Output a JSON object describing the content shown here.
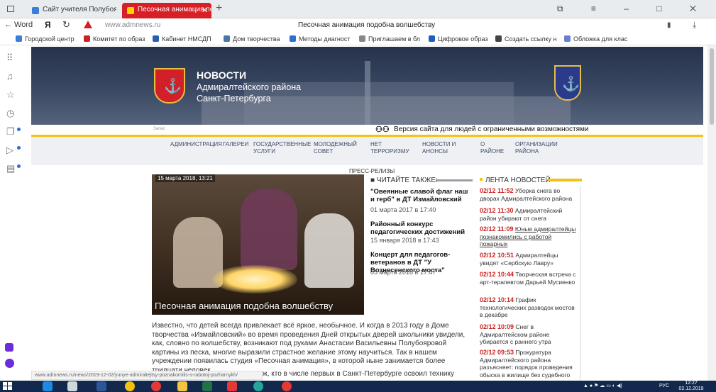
{
  "browser": {
    "tabs": [
      {
        "label": "Сайт учителя Полубояро"
      },
      {
        "label": "Песочная анимация по"
      }
    ],
    "new_tab": "+",
    "back_label": "← Word",
    "yandex": "Я",
    "reload": "↻",
    "url": "www.admnews.ru",
    "page_title": "Песочная анимация подобна волшебству",
    "window_controls": "⧉ ≡ – □ ✕",
    "bookmark_icon": "bookmark-icon",
    "download_icon": "download-icon",
    "bookmarks": [
      {
        "label": "Городской центр",
        "color": "#3b7dd8"
      },
      {
        "label": "Комитет по образ",
        "color": "#c22"
      },
      {
        "label": "Кабинет НМСДП",
        "color": "#2a5ea8"
      },
      {
        "label": "Дом творчества",
        "color": "#4a76a8"
      },
      {
        "label": "Методы диагност",
        "color": "#2b6fd6"
      },
      {
        "label": "Приглашаем в бл",
        "color": "#888"
      },
      {
        "label": "Цифровое образ",
        "color": "#1f5fbf"
      },
      {
        "label": "Создать ссылку н",
        "color": "#444"
      },
      {
        "label": "Обложка для клас",
        "color": "#6b7fd0"
      }
    ],
    "status_url": "www.admnews.ru/news/2019-12-02/yunye-admiraltejtsy-poznakomilis-s-rabotoj-pozharnykh/"
  },
  "site": {
    "brand": {
      "title": "НОВОСТИ",
      "line1": "Адмиралтейского района",
      "line2": "Санкт-Петербурга"
    },
    "search_placeholder": "Запис",
    "accessibility_icon": "⚇⚇",
    "accessibility_text": "Версия сайта для людей с ограниченными возможностями",
    "nav": [
      "АДМИНИСТРАЦИЯ",
      "ГАЛЕРЕИ",
      "ГОСУДАРСТВЕННЫЕ УСЛУГИ",
      "МОЛОДЕЖНЫЙ СОВЕТ",
      "НЕТ ТЕРРОРИЗМУ",
      "НОВОСТИ И АНОНСЫ",
      "О РАЙОНЕ",
      "ОРГАНИЗАЦИИ РАЙОНА"
    ],
    "section_label": "ПРЕСС-РЕЛИЗЫ",
    "hero": {
      "date": "15 марта 2018, 13:21",
      "caption": "Песочная анимация подобна волшебству"
    },
    "article": {
      "text": "Известно, что детей всегда привлекает всё яркое, необычное. И когда в 2013 году в Доме творчества «Измайловский» во время проведения Дней открытых дверей школьники увидели, как, словно по волшебству, возникают под руками Анастасии Васильевны Полубояровой картины из песка, многие выразили страстное желание этому научиться. Так в нашем учреждении появилась студия «Песочная анимация», в которой ныне занимается более тридцати человек.",
      "continuation": "ж, кто в числе первых в Санкт-Петербурге освоил технику"
    },
    "read_also": {
      "heading": "■ ЧИТАЙТЕ ТАКЖЕ:",
      "items": [
        {
          "title": "\"Овеянные славой флаг наш и герб\" в ДТ Измайловский",
          "date": "01 марта 2017 в 17:40"
        },
        {
          "title": "Районный конкурс педагогических достижений",
          "date": "15 января 2018 в 17:43"
        },
        {
          "title": "Концерт для педагогов-ветеранов в ДТ \"У Вознесенского моста\"",
          "date": "05 марта 2018 в 17:47"
        }
      ]
    },
    "feed": {
      "heading": "ЛЕНТА НОВОСТЕЙ",
      "items": [
        {
          "time": "02/12 11:52",
          "text": "Уборка снега во дворах Адмиралтейского района"
        },
        {
          "time": "02/12 11:30",
          "text": "Адмиралтейский район убирают от снега"
        },
        {
          "time": "02/12 11:09",
          "text": "Юные адмиралтейцы познакомились с работой пожарных"
        },
        {
          "time": "02/12 10:51",
          "text": "Адмиралтейцы увидят «Сербскую Лавру»"
        },
        {
          "time": "02/12 10:44",
          "text": "Творческая встреча с арт-терапевтом Дарьей Мусиенко"
        },
        {
          "time": "02/12 10:14",
          "text": "График технологических разводок мостов в декабре"
        },
        {
          "time": "02/12 10:09",
          "text": "Снег в Адмиралтейском районе убирается с раннего утра"
        },
        {
          "time": "02/12 09:53",
          "text": "Прокуратура Адмиралтейского района разъясняет: порядок проведения обыска в жилище без судебного"
        }
      ]
    }
  },
  "taskbar": {
    "apps": [
      {
        "name": "edge-icon",
        "color": "#1e88e5"
      },
      {
        "name": "media-icon",
        "color": "#cfd8dc"
      },
      {
        "name": "word-icon",
        "color": "#2b579a"
      },
      {
        "name": "chrome-icon",
        "color": "#f4c20d"
      },
      {
        "name": "opera-icon",
        "color": "#e53935"
      },
      {
        "name": "explorer-icon",
        "color": "#f6c343"
      },
      {
        "name": "excel-icon",
        "color": "#217346"
      },
      {
        "name": "video-icon",
        "color": "#e53935"
      },
      {
        "name": "chat-icon",
        "color": "#26a69a"
      },
      {
        "name": "yandex-browser-icon",
        "color": "#e53935"
      }
    ],
    "lang": "РУС",
    "time": "12:27",
    "date": "02.12.2019"
  }
}
